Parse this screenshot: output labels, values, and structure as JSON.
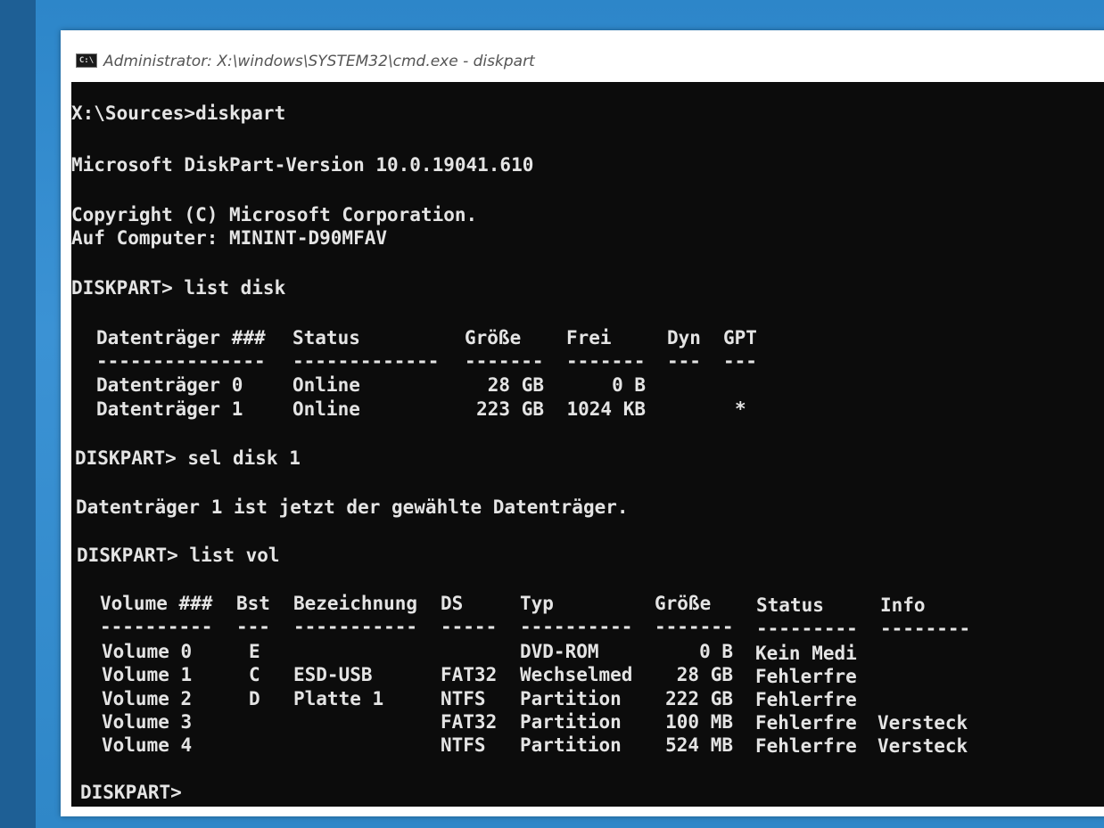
{
  "window": {
    "title": "Administrator: X:\\windows\\SYSTEM32\\cmd.exe - diskpart",
    "icon": "cmd-icon"
  },
  "console": {
    "prompt1": "X:\\Sources>diskpart",
    "version": "Microsoft DiskPart-Version 10.0.19041.610",
    "copyright": "Copyright (C) Microsoft Corporation.",
    "computer": "Auf Computer: MININT-D90MFAV",
    "cmd_list_disk": "DISKPART> list disk",
    "disk_table": {
      "headers": [
        "Datenträger ###",
        "Status",
        "Größe",
        "Frei",
        "Dyn",
        "GPT"
      ],
      "separators": [
        "---------------",
        "-------------",
        "-------",
        "-------",
        "---",
        "---"
      ],
      "rows": [
        [
          "Datenträger 0",
          "Online",
          "28 GB",
          "0 B",
          "",
          ""
        ],
        [
          "Datenträger 1",
          "Online",
          "223 GB",
          "1024 KB",
          "",
          "*"
        ]
      ]
    },
    "cmd_sel_disk": "DISKPART> sel disk 1",
    "sel_result": "Datenträger 1 ist jetzt der gewählte Datenträger.",
    "cmd_list_vol": "DISKPART> list vol",
    "vol_table": {
      "headers": [
        "Volume ###",
        "Bst",
        "Bezeichnung",
        "DS",
        "Typ",
        "Größe",
        "Status",
        "Info"
      ],
      "separators": [
        "----------",
        "---",
        "-----------",
        "-----",
        "----------",
        "-------",
        "---------",
        "--------"
      ],
      "rows": [
        [
          "Volume 0",
          "E",
          "",
          "",
          "DVD-ROM",
          "0 B",
          "Kein Medi",
          ""
        ],
        [
          "Volume 1",
          "C",
          "ESD-USB",
          "FAT32",
          "Wechselmed",
          "28 GB",
          "Fehlerfre",
          ""
        ],
        [
          "Volume 2",
          "D",
          "Platte 1",
          "NTFS",
          "Partition",
          "222 GB",
          "Fehlerfre",
          ""
        ],
        [
          "Volume 3",
          "",
          "",
          "FAT32",
          "Partition",
          "100 MB",
          "Fehlerfre",
          "Versteck"
        ],
        [
          "Volume 4",
          "",
          "",
          "NTFS",
          "Partition",
          "524 MB",
          "Fehlerfre",
          "Versteck"
        ]
      ]
    },
    "final_prompt": "DISKPART>"
  }
}
